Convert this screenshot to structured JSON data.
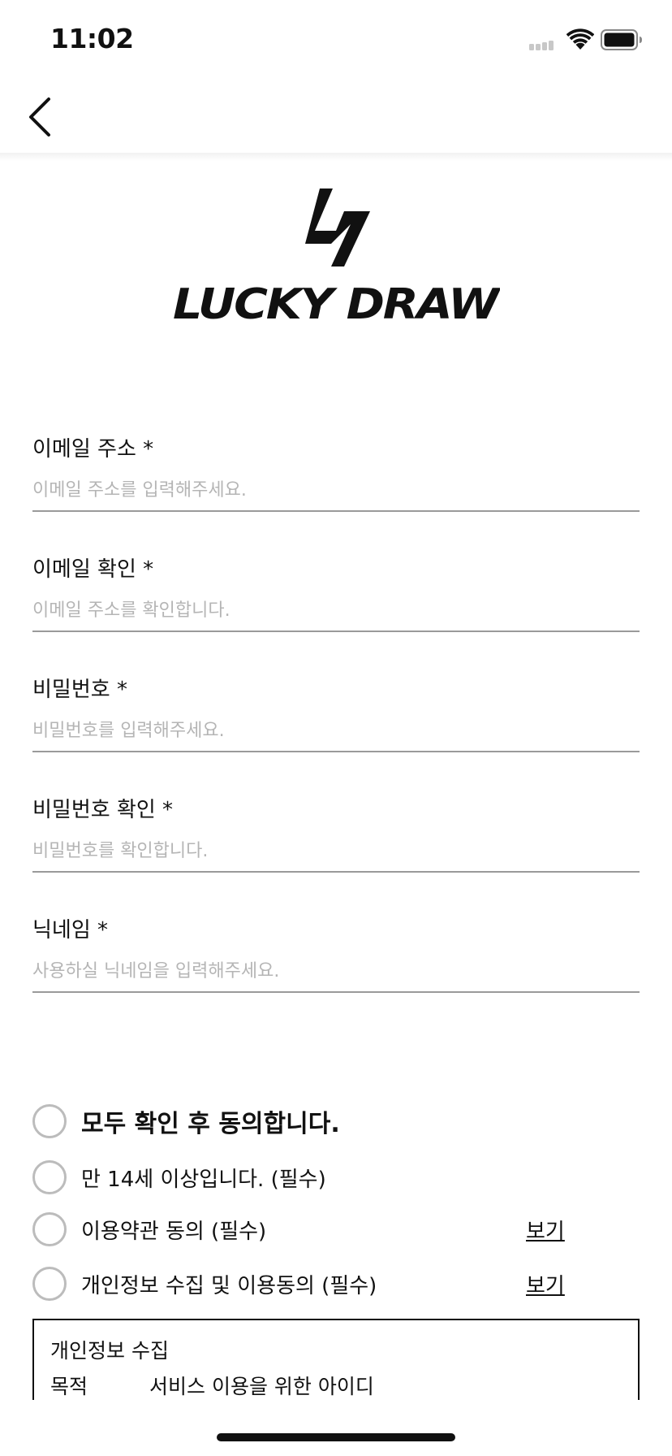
{
  "status_bar": {
    "time": "11:02"
  },
  "brand": {
    "name": "LUCKY DRAW"
  },
  "form": {
    "fields": [
      {
        "label": "이메일 주소 *",
        "placeholder": "이메일 주소를 입력해주세요.",
        "value": ""
      },
      {
        "label": "이메일 확인 *",
        "placeholder": "이메일 주소를 확인합니다.",
        "value": ""
      },
      {
        "label": "비밀번호 *",
        "placeholder": "비밀번호를 입력해주세요.",
        "value": ""
      },
      {
        "label": "비밀번호 확인 *",
        "placeholder": "비밀번호를 확인합니다.",
        "value": ""
      },
      {
        "label": "닉네임 *",
        "placeholder": "사용하실 닉네임을 입력해주세요.",
        "value": ""
      }
    ]
  },
  "agreements": {
    "all": {
      "label": "모두 확인 후 동의합니다.",
      "checked": false
    },
    "items": [
      {
        "label": "만 14세 이상입니다. (필수)",
        "checked": false
      },
      {
        "label": "이용약관 동의 (필수)",
        "link": "보기",
        "checked": false
      },
      {
        "label": "개인정보 수집 및 이용동의 (필수)",
        "link": "보기",
        "checked": false
      }
    ]
  },
  "privacy": {
    "title": "개인정보 수집",
    "rows": [
      {
        "key": "목적",
        "value": "서비스 이용을 위한 아이디"
      }
    ]
  },
  "colors": {
    "text": "#111111",
    "placeholder": "#b5b5b5",
    "underline": "#9a9a9a",
    "radio_border": "#bcbcbc"
  }
}
